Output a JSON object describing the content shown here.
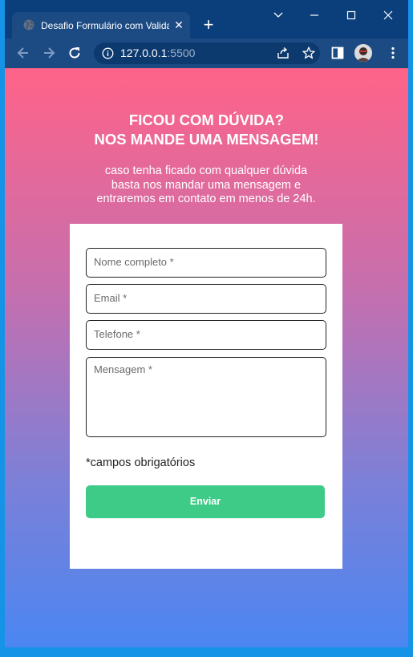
{
  "browser": {
    "tab_title": "Desafio Formulário com Validação",
    "url_host": "127.0.0.1",
    "url_port": ":5500"
  },
  "page": {
    "headline_line1": "FICOU COM DÚVIDA?",
    "headline_line2": "NOS MANDE UMA MENSAGEM!",
    "sub_line1": "caso tenha ficado com qualquer dúvida",
    "sub_line2": "basta nos mandar uma mensagem e",
    "sub_line3": "entraremos em contato em menos de 24h."
  },
  "form": {
    "name_placeholder": "Nome completo *",
    "email_placeholder": "Email *",
    "phone_placeholder": "Telefone *",
    "message_placeholder": "Mensagem *",
    "required_note": "*campos obrigatórios",
    "submit_label": "Enviar"
  },
  "colors": {
    "gradient_top": "#ff6388",
    "gradient_bottom": "#4b86f2",
    "submit_button": "#3ecb87",
    "browser_chrome": "#1c4a83"
  }
}
